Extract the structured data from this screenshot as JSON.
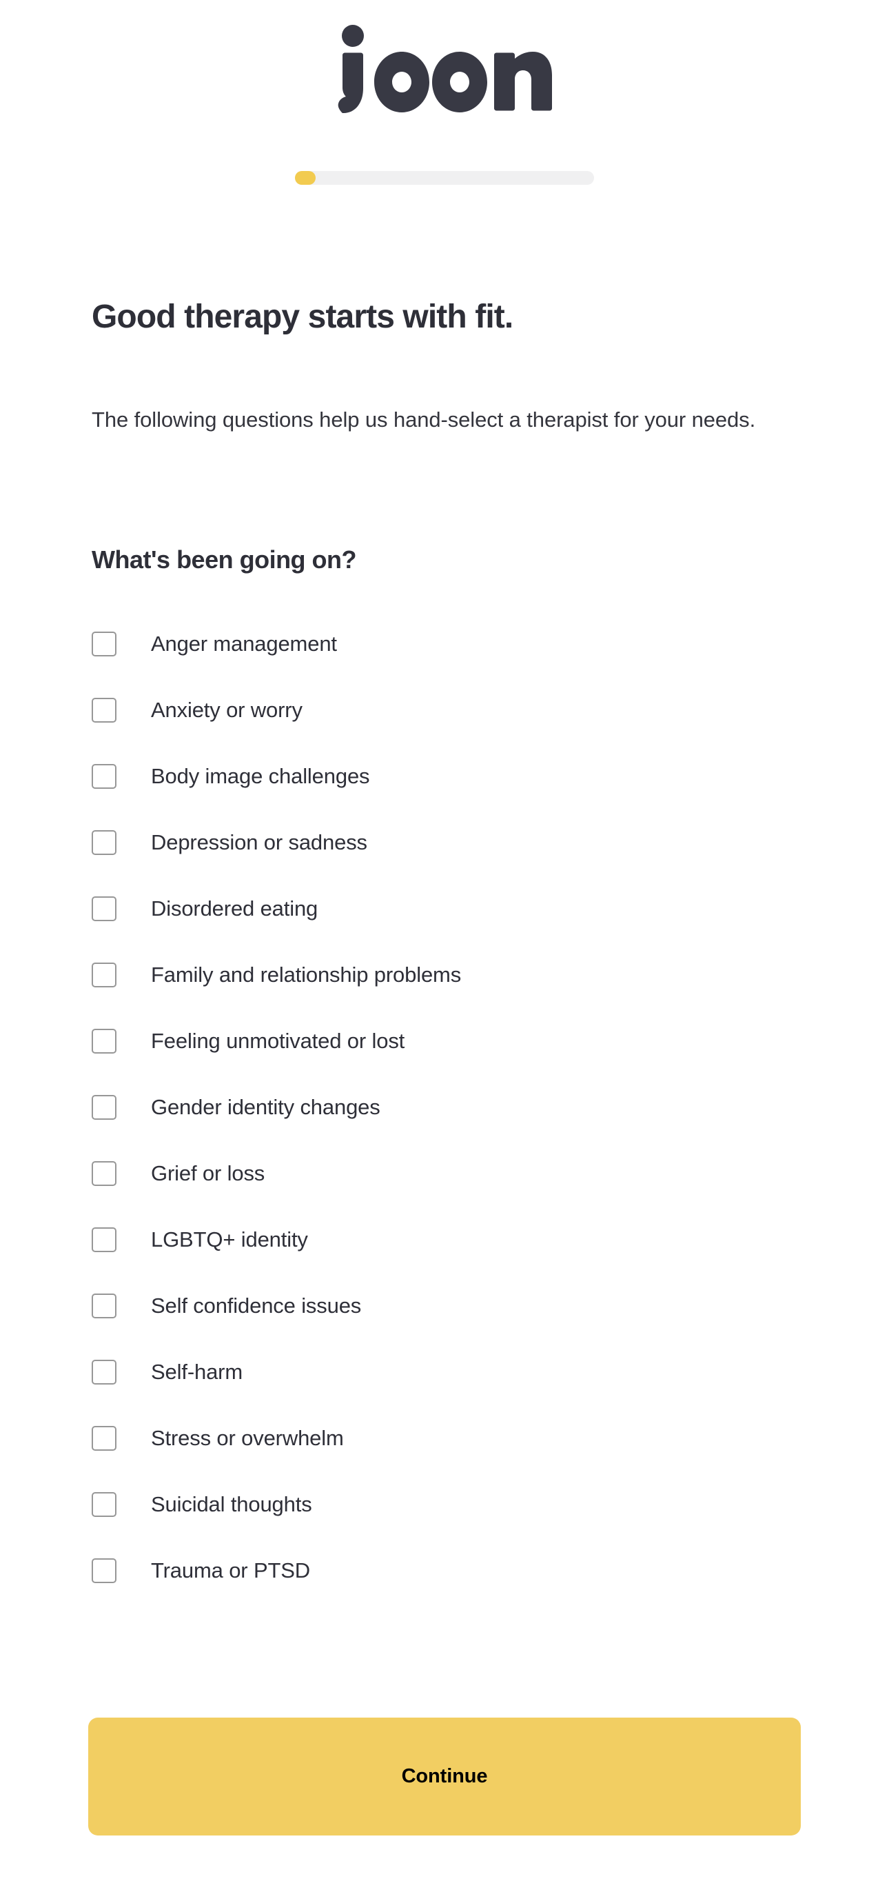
{
  "brand": {
    "logo_text": "joon",
    "logo_color": "#383944",
    "accent_color": "#f2cb50",
    "button_color": "#f2ce62",
    "text_color": "#2e2f38",
    "checkbox_border_color": "#979797",
    "progress_track_color": "#f0f0f1"
  },
  "progress": {
    "label": "onboarding-progress",
    "percent": 7
  },
  "header": {
    "title": "Good therapy starts with fit.",
    "subtitle": "The following questions help us hand-select a therapist for your needs."
  },
  "question": {
    "prompt": "What's been going on?",
    "options": [
      {
        "label": "Anger management",
        "checked": false
      },
      {
        "label": "Anxiety or worry",
        "checked": false
      },
      {
        "label": "Body image challenges",
        "checked": false
      },
      {
        "label": "Depression or sadness",
        "checked": false
      },
      {
        "label": "Disordered eating",
        "checked": false
      },
      {
        "label": "Family and relationship problems",
        "checked": false
      },
      {
        "label": "Feeling unmotivated or lost",
        "checked": false
      },
      {
        "label": "Gender identity changes",
        "checked": false
      },
      {
        "label": "Grief or loss",
        "checked": false
      },
      {
        "label": "LGBTQ+ identity",
        "checked": false
      },
      {
        "label": "Self confidence issues",
        "checked": false
      },
      {
        "label": "Self-harm",
        "checked": false
      },
      {
        "label": "Stress or overwhelm",
        "checked": false
      },
      {
        "label": "Suicidal thoughts",
        "checked": false
      },
      {
        "label": "Trauma or PTSD",
        "checked": false
      }
    ]
  },
  "footer": {
    "continue_label": "Continue"
  }
}
